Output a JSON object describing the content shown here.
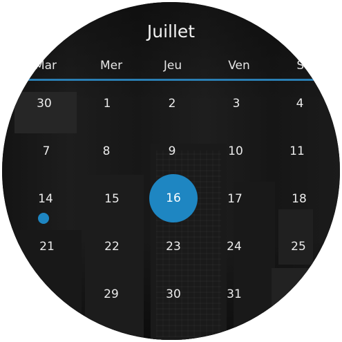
{
  "month_title": "Juillet",
  "weekdays": [
    "Mar",
    "Mer",
    "Jeu",
    "Ven",
    "Sa"
  ],
  "weeks": [
    [
      "30",
      "1",
      "2",
      "3",
      "4"
    ],
    [
      "7",
      "8",
      "9",
      "10",
      "11"
    ],
    [
      "14",
      "15",
      "16",
      "17",
      "18"
    ],
    [
      "21",
      "22",
      "23",
      "24",
      "25"
    ],
    [
      "",
      "29",
      "30",
      "31",
      ""
    ]
  ],
  "selected_day": "16",
  "event_day": "14",
  "colors": {
    "accent": "#1e86c2",
    "background": "#161616",
    "text": "#ececec"
  }
}
